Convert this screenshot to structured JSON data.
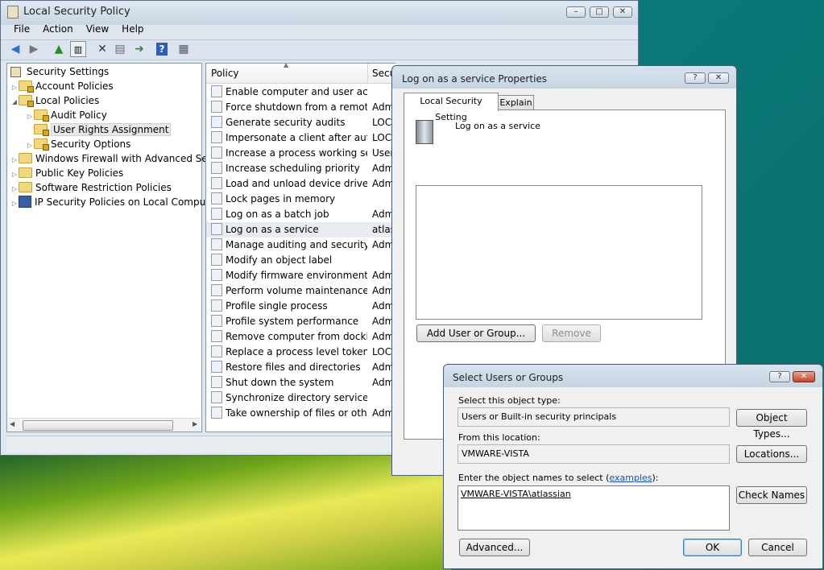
{
  "main_window": {
    "title": "Local Security Policy",
    "caption_buttons": {
      "minimize": "–",
      "maximize": "□",
      "close": "✕"
    },
    "menu": [
      "File",
      "Action",
      "View",
      "Help"
    ],
    "toolbar": [
      "back-icon",
      "forward-icon",
      "up-folder-icon",
      "show-tree-icon",
      "delete-icon",
      "properties-icon",
      "export-icon",
      "help-icon",
      "console-icon"
    ],
    "tree": [
      {
        "label": "Security Settings",
        "icon": "security-settings-icon"
      },
      {
        "label": "Account Policies",
        "icon": "folder-lock-icon"
      },
      {
        "label": "Local Policies",
        "icon": "folder-lock-icon"
      },
      {
        "label": "Audit Policy",
        "icon": "folder-lock-icon"
      },
      {
        "label": "User Rights Assignment",
        "icon": "folder-lock-icon"
      },
      {
        "label": "Security Options",
        "icon": "folder-lock-icon"
      },
      {
        "label": "Windows Firewall with Advanced Secu",
        "icon": "folder-icon"
      },
      {
        "label": "Public Key Policies",
        "icon": "folder-icon"
      },
      {
        "label": "Software Restriction Policies",
        "icon": "folder-icon"
      },
      {
        "label": "IP Security Policies on Local Compute",
        "icon": "ip-security-icon"
      }
    ],
    "list_headers": {
      "policy": "Policy",
      "security": "Secu"
    },
    "list_rows": [
      {
        "policy": "Enable computer and user acco...",
        "security": ""
      },
      {
        "policy": "Force shutdown from a remote ...",
        "security": "Adm"
      },
      {
        "policy": "Generate security audits",
        "security": "LOCA"
      },
      {
        "policy": "Impersonate a client after authe...",
        "security": "LOCA"
      },
      {
        "policy": "Increase a process working set",
        "security": "Users"
      },
      {
        "policy": "Increase scheduling priority",
        "security": "Adm"
      },
      {
        "policy": "Load and unload device drivers",
        "security": "Adm"
      },
      {
        "policy": "Lock pages in memory",
        "security": ""
      },
      {
        "policy": "Log on as a batch job",
        "security": "Adm"
      },
      {
        "policy": "Log on as a service",
        "security": "atlas"
      },
      {
        "policy": "Manage auditing and security l...",
        "security": "Adm"
      },
      {
        "policy": "Modify an object label",
        "security": ""
      },
      {
        "policy": "Modify firmware environment ...",
        "security": "Adm"
      },
      {
        "policy": "Perform volume maintenance t...",
        "security": "Adm"
      },
      {
        "policy": "Profile single process",
        "security": "Adm"
      },
      {
        "policy": "Profile system performance",
        "security": "Adm"
      },
      {
        "policy": "Remove computer from dockin...",
        "security": "Adm"
      },
      {
        "policy": "Replace a process level token",
        "security": "LOCA"
      },
      {
        "policy": "Restore files and directories",
        "security": "Adm"
      },
      {
        "policy": "Shut down the system",
        "security": "Adm"
      },
      {
        "policy": "Synchronize directory service d...",
        "security": ""
      },
      {
        "policy": "Take ownership of files or other...",
        "security": "Adm"
      }
    ]
  },
  "properties_dialog": {
    "title": "Log on as a service Properties",
    "tabs": [
      "Local Security Setting",
      "Explain"
    ],
    "policy_name": "Log on as a service",
    "add_button": "Add User or Group...",
    "remove_button": "Remove",
    "help_glyph": "?",
    "close_glyph": "✕"
  },
  "select_dialog": {
    "title": "Select Users or Groups",
    "object_type_label": "Select this object type:",
    "object_type_value": "Users or Built-in security principals",
    "object_types_button": "Object Types...",
    "location_label": "From this location:",
    "location_value": "VMWARE-VISTA",
    "locations_button": "Locations...",
    "names_label_pre": "Enter the object names to select (",
    "names_label_link": "examples",
    "names_label_post": "):",
    "names_value": "VMWARE-VISTA\\atlassian",
    "check_names_button": "Check Names",
    "advanced_button": "Advanced...",
    "ok_button": "OK",
    "cancel_button": "Cancel",
    "help_glyph": "?",
    "close_glyph": "✕"
  }
}
